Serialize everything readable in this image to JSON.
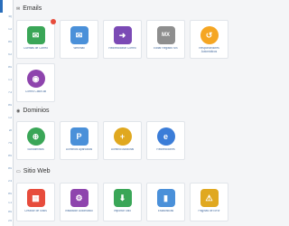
{
  "sidebar": {
    "items": [
      "3Q",
      "1.2",
      "0%",
      "9.2",
      "0%",
      "1.1",
      "7.4",
      "0%",
      "1.2",
      "22",
      "7.9",
      "0%",
      "0%",
      "2.3",
      "0%",
      "1.1",
      "0%",
      "2.5"
    ]
  },
  "sections": {
    "emails": {
      "title": "Emails",
      "tiles": [
        {
          "label": "Cuentas de Correo",
          "icon": "mail-inbox-icon",
          "color": "#3aa657"
        },
        {
          "label": "Webmail",
          "icon": "webmail-icon",
          "color": "#4a90d9"
        },
        {
          "label": "Redireccionar Correo",
          "icon": "forwarder-icon",
          "color": "#7b4ab5"
        },
        {
          "label": "Editar Registro MX",
          "icon": "mx-record-icon",
          "color": "#8e8e8e"
        },
        {
          "label": "Respondedores Automáticos",
          "icon": "autoresponder-icon",
          "color": "#f5a623"
        },
        {
          "label": "Correo Catch-all",
          "icon": "catch-all-icon",
          "color": "#8e44ad"
        }
      ]
    },
    "domains": {
      "title": "Dominios",
      "tiles": [
        {
          "label": "Subdominios",
          "icon": "subdomain-icon",
          "color": "#3aa657"
        },
        {
          "label": "Dominios Aparcados",
          "icon": "parked-domain-icon",
          "color": "#4a90d9"
        },
        {
          "label": "Dominio Adicional",
          "icon": "addon-domain-icon",
          "color": "#e0a81f"
        },
        {
          "label": "Redirecciones",
          "icon": "redirect-icon",
          "color": "#3b7dd8"
        }
      ]
    },
    "website": {
      "title": "Sitio Web",
      "tiles": [
        {
          "label": "Creador de Sitios",
          "icon": "site-builder-icon",
          "color": "#e74c3c"
        },
        {
          "label": "Instalador Automático",
          "icon": "auto-installer-icon",
          "color": "#8e44ad"
        },
        {
          "label": "Importar Sitio",
          "icon": "import-site-icon",
          "color": "#3aa657"
        },
        {
          "label": "Estadísticas",
          "icon": "statistics-icon",
          "color": "#4a90d9"
        },
        {
          "label": "Páginas de Error",
          "icon": "error-pages-icon",
          "color": "#e0a81f"
        }
      ]
    }
  }
}
